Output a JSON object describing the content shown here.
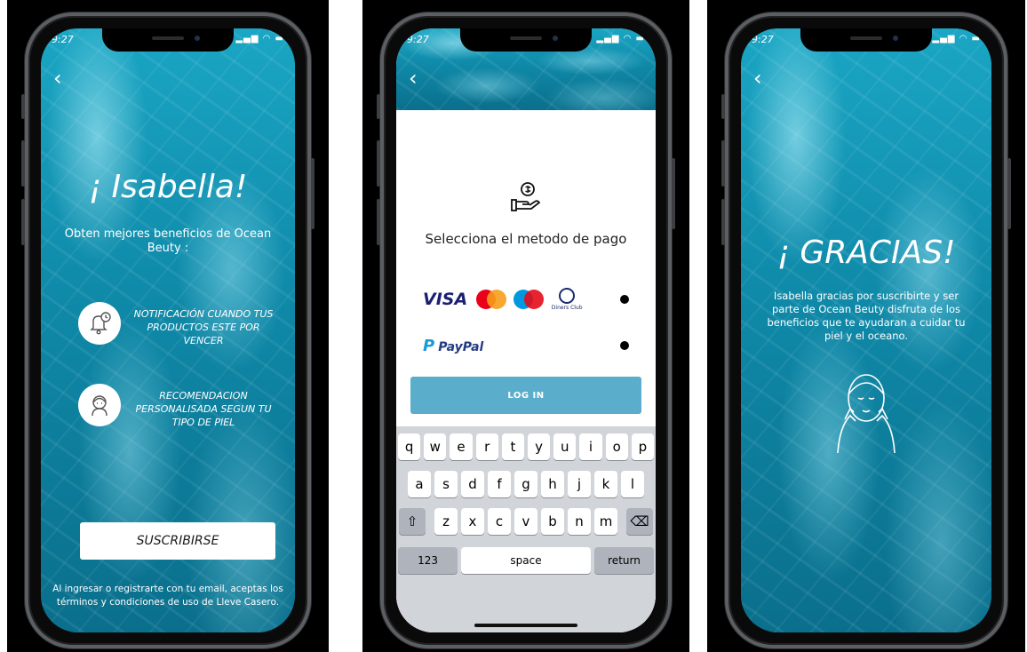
{
  "status": {
    "time": "9:27",
    "icons": "▂▄▆ ◠ ▬"
  },
  "screen1": {
    "back": "‹",
    "greeting": "¡ Isabella!",
    "subtitle": "Obten mejores beneficios de Ocean Beuty :",
    "features": [
      {
        "icon": "bell-clock-icon",
        "text": "NOTIFICACIÓN CUANDO TUS PRODUCTOS ESTE POR VENCER"
      },
      {
        "icon": "face-recommendation-icon",
        "text": "RECOMENDACION PERSONALISADA SEGUN TU TIPO DE PIEL"
      }
    ],
    "subscribe_label": "SUSCRIBIRSE",
    "legal": "Al ingresar o registrarte con tu email, aceptas los términos y condiciones de uso de Lleve Casero."
  },
  "screen2": {
    "back": "‹",
    "pay_icon": "hand-coin-icon",
    "title": "Selecciona el metodo de pago",
    "cards": {
      "visa": "VISA",
      "mastercard": "MasterCard",
      "maestro": "Maestro",
      "diners": "Diners Club"
    },
    "paypal": {
      "p": "P",
      "label": "PayPal"
    },
    "login_label": "LOG IN",
    "keyboard": {
      "row1": [
        "q",
        "w",
        "e",
        "r",
        "t",
        "y",
        "u",
        "i",
        "o",
        "p"
      ],
      "row2": [
        "a",
        "s",
        "d",
        "f",
        "g",
        "h",
        "j",
        "k",
        "l"
      ],
      "row3": [
        "z",
        "x",
        "c",
        "v",
        "b",
        "n",
        "m"
      ],
      "shift": "⇧",
      "backspace": "⌫",
      "numbers": "123",
      "space": "space",
      "return": "return"
    }
  },
  "screen3": {
    "back": "‹",
    "title": "¡ GRACIAS!",
    "message": "Isabella gracias por suscribirte y ser parte de Ocean Beuty disfruta de los beneficios que te ayudaran a cuidar tu piel y el oceano."
  }
}
